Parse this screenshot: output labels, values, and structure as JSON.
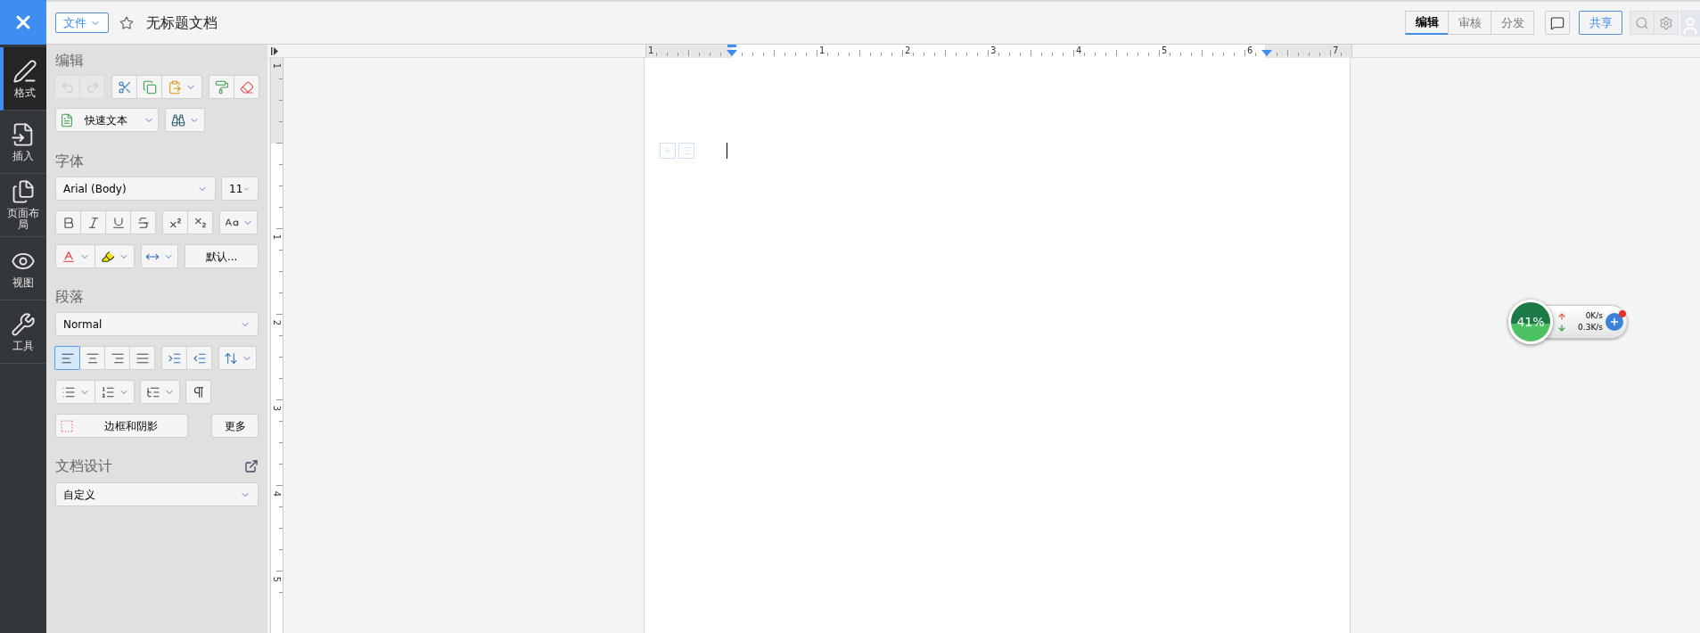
{
  "rail": [
    {
      "label": "格式",
      "kind": "format",
      "selected": true
    },
    {
      "label": "插入",
      "kind": "insert",
      "selected": false
    },
    {
      "label": "页面布局",
      "kind": "layout",
      "selected": false
    },
    {
      "label": "视图",
      "kind": "view",
      "selected": false
    },
    {
      "label": "工具",
      "kind": "tools",
      "selected": false
    }
  ],
  "top_bar": {
    "file_menu": "文件",
    "title": "无标题文档",
    "mode_tabs": [
      {
        "label": "编辑",
        "selected": true
      },
      {
        "label": "审核",
        "selected": false
      },
      {
        "label": "分发",
        "selected": false
      }
    ],
    "share": "共享"
  },
  "edit_section": {
    "heading": "编辑",
    "history": [
      {
        "kind": "undo",
        "disabled": true
      },
      {
        "kind": "redo",
        "disabled": true
      }
    ],
    "quick_text": "快速文本"
  },
  "font_section": {
    "heading": "字体",
    "font": "Arial (Body)",
    "size": "11",
    "default_button": "默认..."
  },
  "paragraph_section": {
    "heading": "段落",
    "style": "Normal",
    "alignments": [
      {
        "kind": "left",
        "selected": true
      },
      {
        "kind": "center",
        "selected": false
      },
      {
        "kind": "right",
        "selected": false
      },
      {
        "kind": "justify",
        "selected": false
      }
    ],
    "borders_button": "边框和阴影",
    "more_button": "更多"
  },
  "design_section": {
    "heading": "文档设计",
    "theme": "自定义"
  },
  "ruler": {
    "horizontal": [
      "1",
      "1",
      "2",
      "3",
      "4",
      "5",
      "6",
      "7"
    ],
    "vertical": [
      "1",
      "1",
      "2",
      "3",
      "4",
      "5"
    ]
  },
  "network_widget": {
    "percent": "41%",
    "upload": "0K/s",
    "download": "0.3K/s"
  }
}
